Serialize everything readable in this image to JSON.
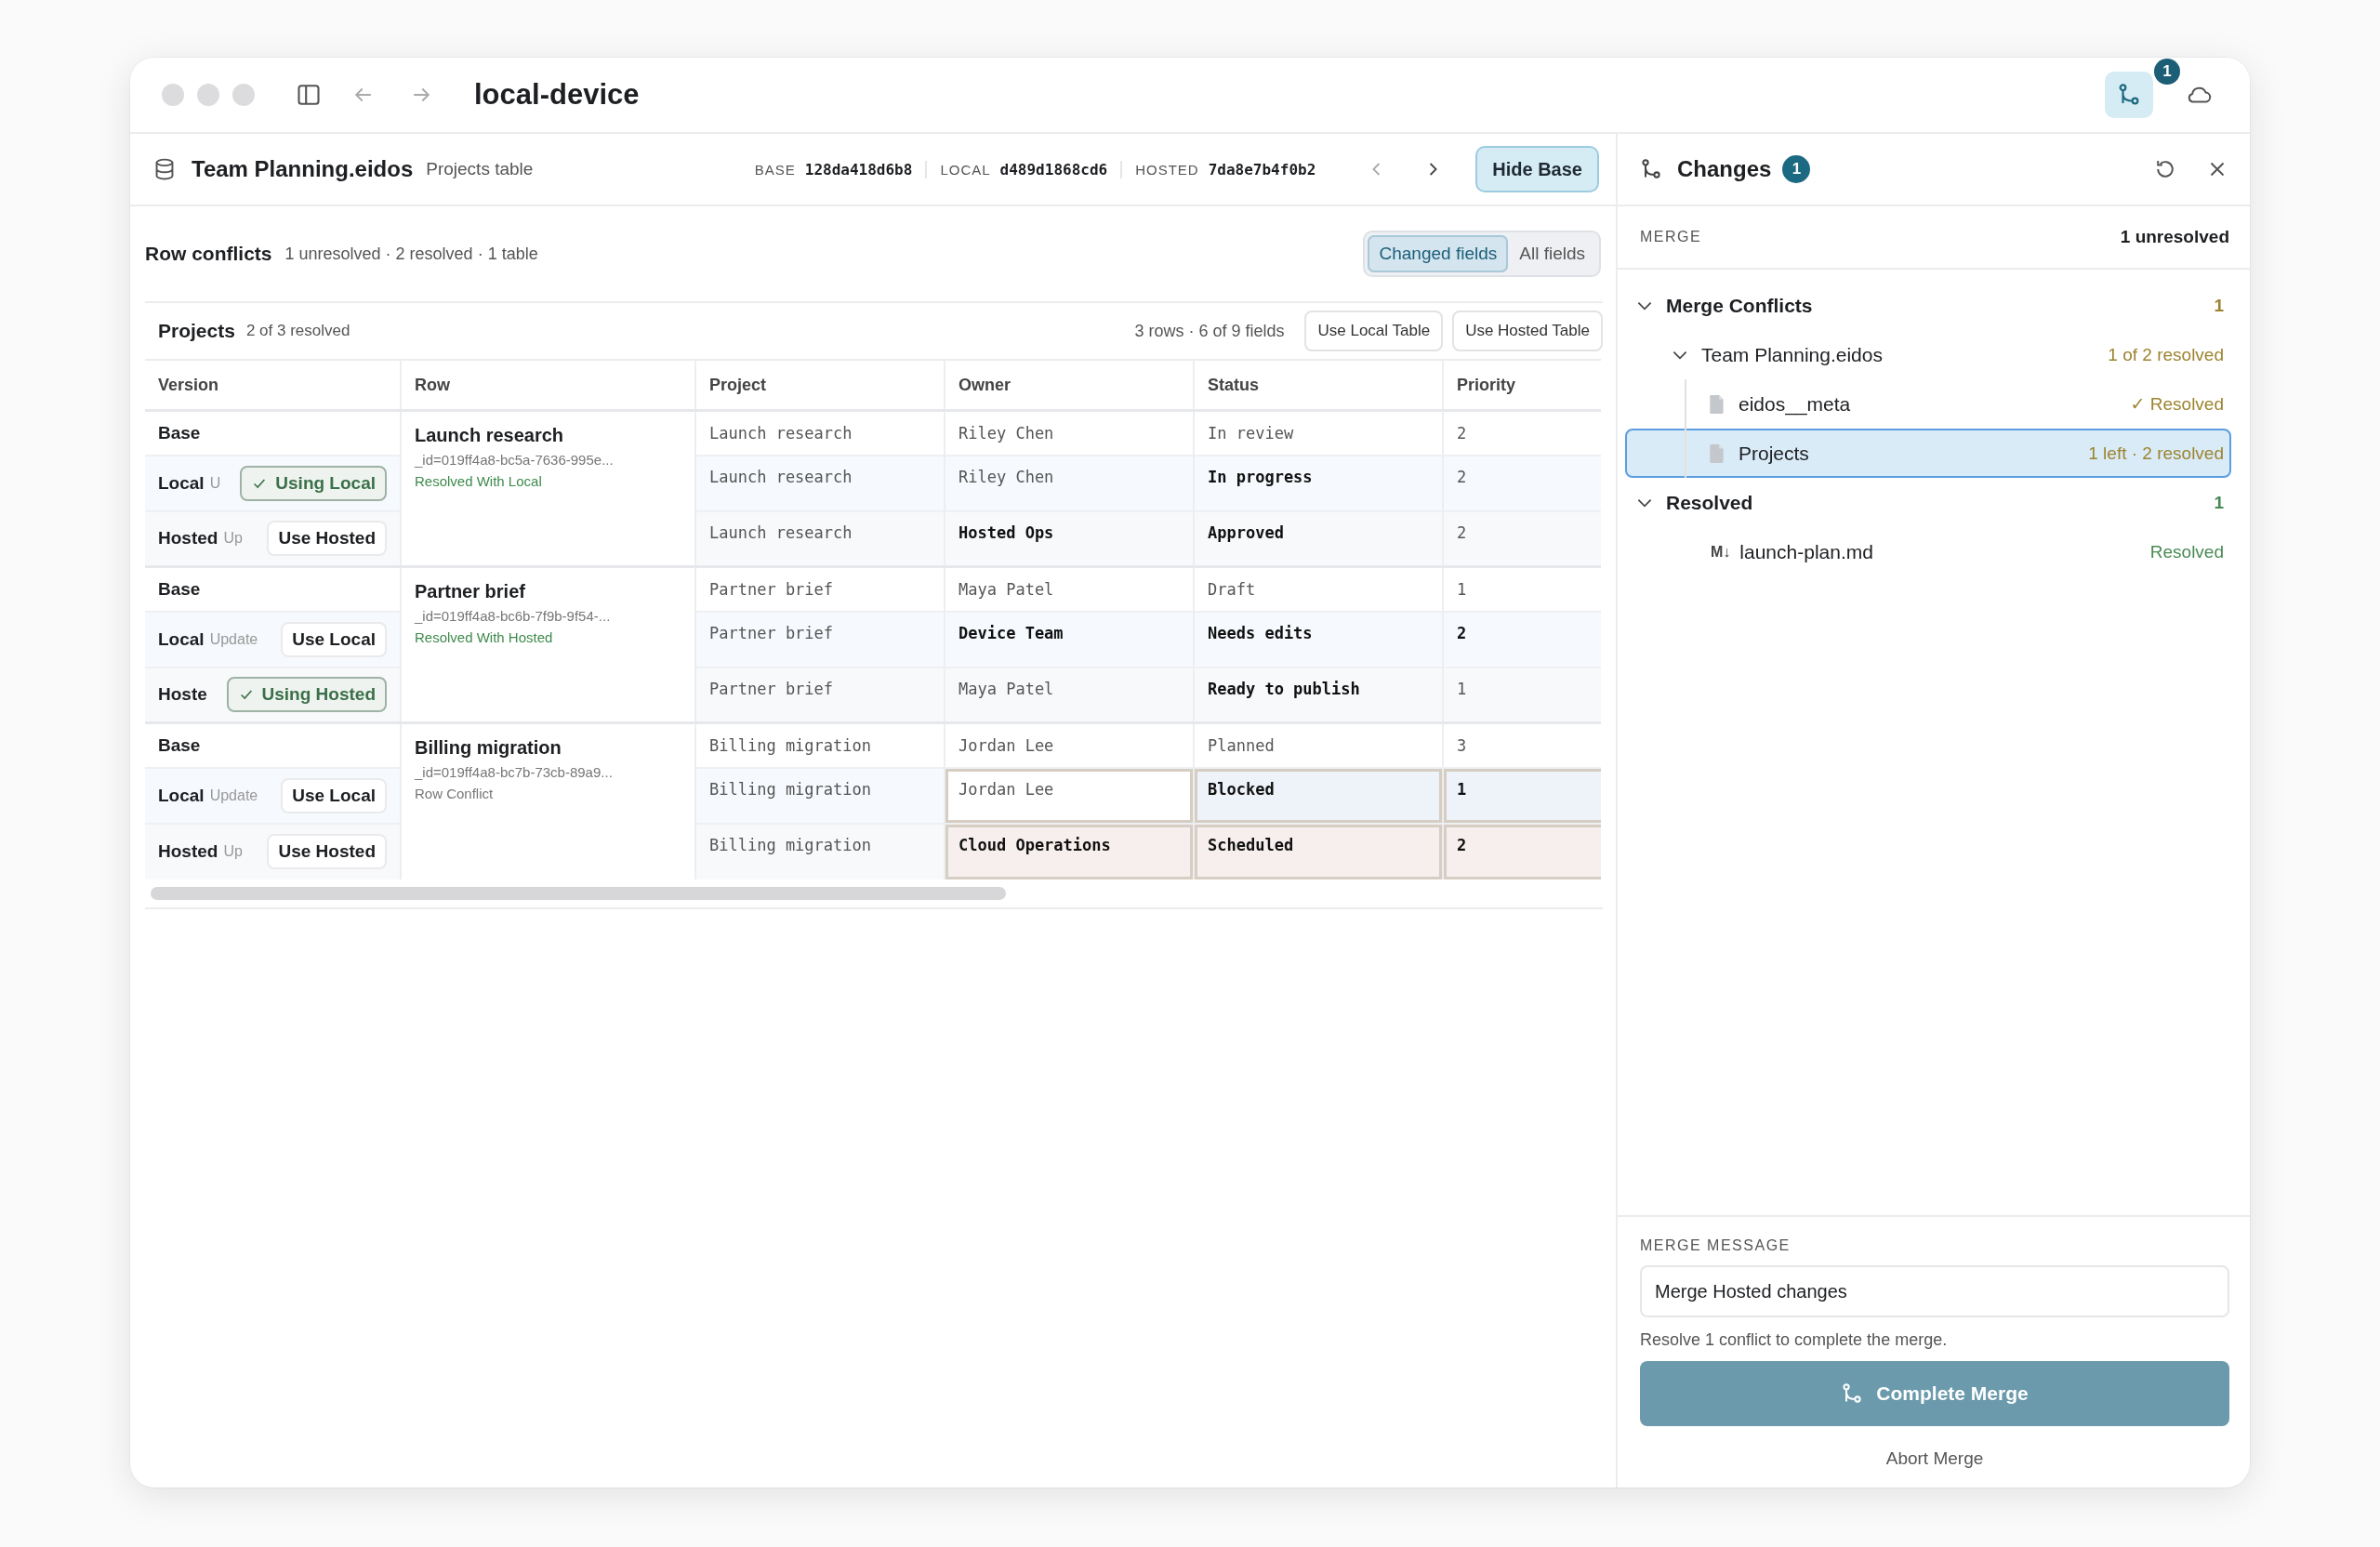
{
  "window": {
    "title": "local-device",
    "changes_badge": "1",
    "changes_open": true
  },
  "document": {
    "name": "Team Planning.eidos",
    "subtitle": "Projects table",
    "revisions": [
      {
        "label": "BASE",
        "hash": "128da418d6b8"
      },
      {
        "label": "LOCAL",
        "hash": "d489d1868cd6"
      },
      {
        "label": "HOSTED",
        "hash": "7da8e7b4f0b2"
      }
    ],
    "hide_base": {
      "label": "Hide Base",
      "active": true
    }
  },
  "conflicts": {
    "title": "Row conflicts",
    "summary": "1 unresolved · 2 resolved · 1 table",
    "view_modes": [
      {
        "label": "Changed fields",
        "selected": true
      },
      {
        "label": "All fields",
        "selected": false
      }
    ]
  },
  "table": {
    "title": "Projects",
    "progress": "2 of 3 resolved",
    "counts": "3 rows · 6 of 9 fields",
    "actions": [
      "Use Local Table",
      "Use Hosted Table"
    ],
    "columns": [
      "Version",
      "Row",
      "Project",
      "Owner",
      "Status",
      "Priority"
    ],
    "groups": [
      {
        "title": "Launch research",
        "id": "_id=019ff4a8-bc5a-7636-995e...",
        "status": "Resolved With Local",
        "resolved": true,
        "versions": [
          {
            "kind": "base",
            "label": "Base",
            "cells": [
              {
                "text": "Launch research",
                "changed": false,
                "conflict": false
              },
              {
                "text": "Riley Chen",
                "changed": false,
                "conflict": false
              },
              {
                "text": "In review",
                "changed": false,
                "conflict": false
              },
              {
                "text": "2",
                "changed": false,
                "conflict": false
              }
            ]
          },
          {
            "kind": "local",
            "label": "Local",
            "tag": "U",
            "action": {
              "label": "Using Local",
              "selected": true
            },
            "cells": [
              {
                "text": "Launch research",
                "changed": false,
                "conflict": false
              },
              {
                "text": "Riley Chen",
                "changed": false,
                "conflict": false
              },
              {
                "text": "In progress",
                "changed": true,
                "conflict": false
              },
              {
                "text": "2",
                "changed": false,
                "conflict": false
              }
            ]
          },
          {
            "kind": "hosted",
            "label": "Hosted",
            "tag": "Up",
            "action": {
              "label": "Use Hosted",
              "selected": false
            },
            "cells": [
              {
                "text": "Launch research",
                "changed": false,
                "conflict": false
              },
              {
                "text": "Hosted Ops",
                "changed": true,
                "conflict": false
              },
              {
                "text": "Approved",
                "changed": true,
                "conflict": false
              },
              {
                "text": "2",
                "changed": false,
                "conflict": false
              }
            ]
          }
        ]
      },
      {
        "title": "Partner brief",
        "id": "_id=019ff4a8-bc6b-7f9b-9f54-...",
        "status": "Resolved With Hosted",
        "resolved": true,
        "versions": [
          {
            "kind": "base",
            "label": "Base",
            "cells": [
              {
                "text": "Partner brief",
                "changed": false,
                "conflict": false
              },
              {
                "text": "Maya Patel",
                "changed": false,
                "conflict": false
              },
              {
                "text": "Draft",
                "changed": false,
                "conflict": false
              },
              {
                "text": "1",
                "changed": false,
                "conflict": false
              }
            ]
          },
          {
            "kind": "local",
            "label": "Local",
            "tag": "Update",
            "action": {
              "label": "Use Local",
              "selected": false
            },
            "cells": [
              {
                "text": "Partner brief",
                "changed": false,
                "conflict": false
              },
              {
                "text": "Device Team",
                "changed": true,
                "conflict": false
              },
              {
                "text": "Needs edits",
                "changed": true,
                "conflict": false
              },
              {
                "text": "2",
                "changed": true,
                "conflict": false
              }
            ]
          },
          {
            "kind": "hosted",
            "label": "Hoste",
            "action": {
              "label": "Using Hosted",
              "selected": true
            },
            "cells": [
              {
                "text": "Partner brief",
                "changed": false,
                "conflict": false
              },
              {
                "text": "Maya Patel",
                "changed": false,
                "conflict": false
              },
              {
                "text": "Ready to publish",
                "changed": true,
                "conflict": false
              },
              {
                "text": "1",
                "changed": false,
                "conflict": false
              }
            ]
          }
        ]
      },
      {
        "title": "Billing migration",
        "id": "_id=019ff4a8-bc7b-73cb-89a9...",
        "status": "Row Conflict",
        "resolved": false,
        "versions": [
          {
            "kind": "base",
            "label": "Base",
            "cells": [
              {
                "text": "Billing migration",
                "changed": false,
                "conflict": false
              },
              {
                "text": "Jordan Lee",
                "changed": false,
                "conflict": false
              },
              {
                "text": "Planned",
                "changed": false,
                "conflict": false
              },
              {
                "text": "3",
                "changed": false,
                "conflict": false
              }
            ]
          },
          {
            "kind": "local",
            "label": "Local",
            "tag": "Update",
            "action": {
              "label": "Use Local",
              "selected": false
            },
            "cells": [
              {
                "text": "Billing migration",
                "changed": false,
                "conflict": false
              },
              {
                "text": "Jordan Lee",
                "changed": false,
                "conflict": true
              },
              {
                "text": "Blocked",
                "changed": true,
                "conflict": true
              },
              {
                "text": "1",
                "changed": true,
                "conflict": true
              }
            ]
          },
          {
            "kind": "hosted",
            "label": "Hosted",
            "tag": "Up",
            "action": {
              "label": "Use Hosted",
              "selected": false
            },
            "cells": [
              {
                "text": "Billing migration",
                "changed": false,
                "conflict": false
              },
              {
                "text": "Cloud Operations",
                "changed": true,
                "conflict": true
              },
              {
                "text": "Scheduled",
                "changed": true,
                "conflict": true
              },
              {
                "text": "2",
                "changed": true,
                "conflict": true
              }
            ]
          }
        ]
      }
    ]
  },
  "changes_panel": {
    "title": "Changes",
    "badge": "1",
    "section_label": "MERGE",
    "section_status": "1 unresolved",
    "tree": [
      {
        "kind": "section",
        "label": "Merge Conflicts",
        "count": "1",
        "resolved": false,
        "expanded": true,
        "selected": false,
        "children": [
          {
            "kind": "file",
            "label": "Team Planning.eidos",
            "count": "1 of 2 resolved",
            "resolved": false,
            "expanded": true,
            "selected": false,
            "children": [
              {
                "kind": "table",
                "label": "eidos__meta",
                "count": "✓ Resolved",
                "resolved": false,
                "selected": false
              },
              {
                "kind": "table",
                "label": "Projects",
                "count": "1 left · 2 resolved",
                "resolved": false,
                "selected": true
              }
            ]
          }
        ]
      },
      {
        "kind": "section",
        "label": "Resolved",
        "count": "1",
        "resolved": true,
        "expanded": true,
        "selected": false,
        "children": [
          {
            "kind": "markdown",
            "glyph": "M↓",
            "label": "launch-plan.md",
            "count": "Resolved",
            "resolved": true,
            "selected": false
          }
        ]
      }
    ],
    "message_label": "MERGE MESSAGE",
    "message": "Merge Hosted changes",
    "hint": "Resolve 1 conflict to complete the merge.",
    "complete": {
      "label": "Complete Merge",
      "disabled": true
    },
    "abort": "Abort Merge"
  }
}
